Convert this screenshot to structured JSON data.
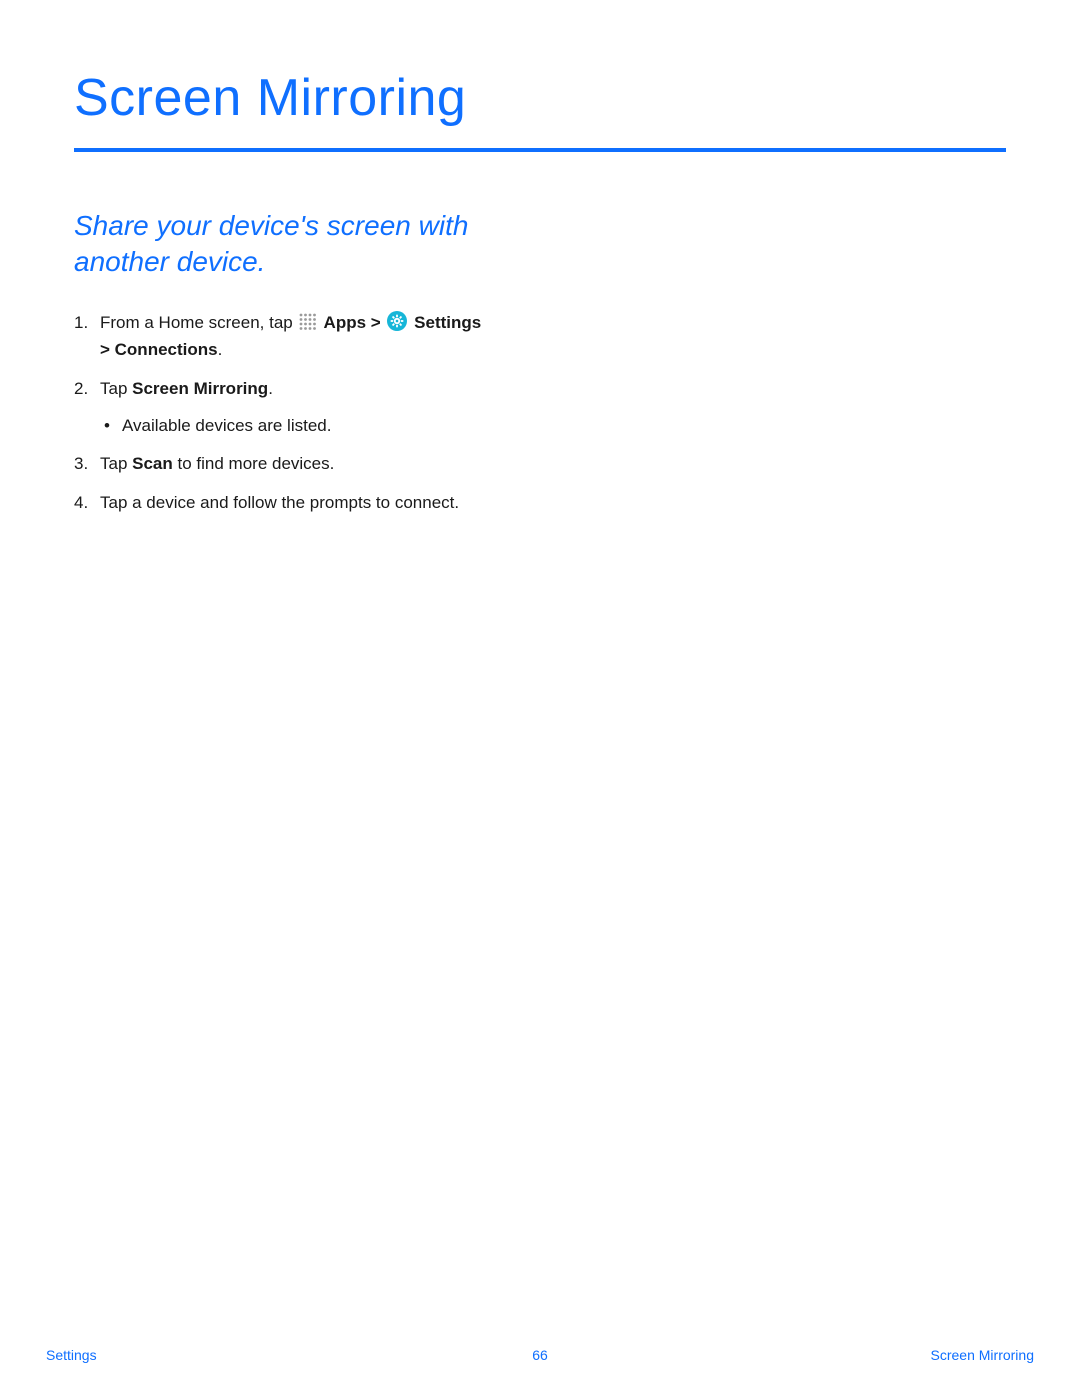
{
  "title": "Screen Mirroring",
  "subtitle": "Share your device's screen with another device.",
  "steps": {
    "s1": {
      "num": "1.",
      "pre": "From a Home screen, tap ",
      "apps_label": " Apps > ",
      "settings_label": " Settings",
      "post": "> Connections",
      "period": "."
    },
    "s2": {
      "num": "2.",
      "pre": "Tap ",
      "bold": "Screen Mirroring",
      "post": ".",
      "bullet": "Available devices are listed."
    },
    "s3": {
      "num": "3.",
      "pre": "Tap ",
      "bold": "Scan",
      "post": " to find more devices."
    },
    "s4": {
      "num": "4.",
      "text": "Tap a device and follow the prompts to connect."
    }
  },
  "footer": {
    "left": "Settings",
    "center": "66",
    "right": "Screen Mirroring"
  }
}
